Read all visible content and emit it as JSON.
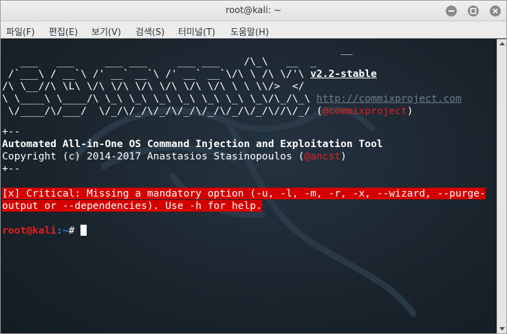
{
  "window": {
    "title": "root@kali: ~"
  },
  "menu": {
    "items": [
      "파일(F)",
      "편집(E)",
      "보기(V)",
      "검색(S)",
      "터미널(T)",
      "도움말(H)"
    ]
  },
  "terminal": {
    "banner": [
      "                                                        __",
      "   ___   ___     ___ ___     ___ ___    /\\_\\   __  _",
      " /`___\\ / __`\\ /' __` __`\\ /' __` __`\\/\\ \\ /\\ \\/'\\",
      "/\\ \\__//\\ \\L\\ \\/\\ \\/\\ \\/\\ \\/\\ \\/\\ \\/\\ \\ \\ \\\\/>  </",
      "\\ \\____\\ \\____/\\ \\_\\ \\_\\ \\_\\ \\_\\ \\_\\ \\_\\ \\_\\/\\_/\\_\\",
      " \\/____/\\/___/  \\/_/\\/_/\\/_/\\/_/\\/_/\\/_/\\/_/\\//\\/_/"
    ],
    "banner_gap": " ",
    "version": "v2.2-stable",
    "website": "http://commixproject.com",
    "paren_open": "(",
    "twitter": "@commixproject",
    "paren_close": ")",
    "sep1": "+--",
    "tool_name": "Automated All-in-One OS Command Injection and Exploitation Tool",
    "copyright_prefix": "Copyright (c) 2014-2017 Anastasios Stasinopoulos (",
    "author_handle": "@ancst",
    "copyright_suffix": ")",
    "sep2": "+--",
    "error_line1": "[x] Critical: Missing a mandatory option (-u, -l, -m, -r, -x, --wizard, --purge-",
    "error_line2": "output or --dependencies). Use -h for help.",
    "prompt_user": "root@kali",
    "prompt_path": ":~",
    "prompt_symbol": "# "
  },
  "colors": {
    "terminal_bg": "#1b252e",
    "error_bg": "#d40000",
    "prompt_user": "#e61e1e",
    "prompt_path": "#3d7bd9",
    "accent_red": "#e01e1e"
  },
  "icons": {
    "minimize": "minimize-icon",
    "maximize": "maximize-icon",
    "close": "close-icon"
  }
}
